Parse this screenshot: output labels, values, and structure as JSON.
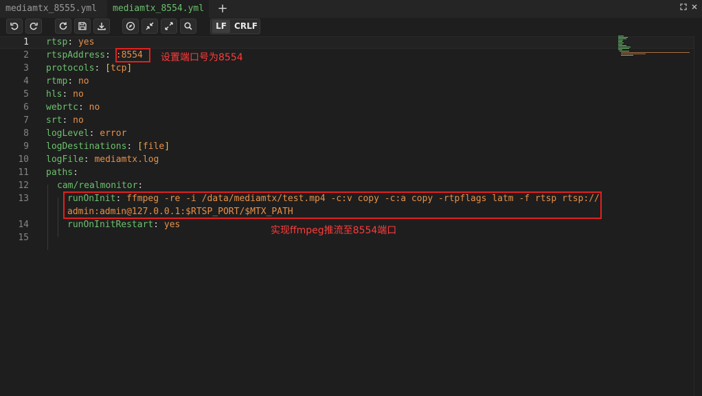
{
  "tabs": [
    {
      "label": "mediamtx_8555.yml",
      "active": false
    },
    {
      "label": "mediamtx_8554.yml",
      "active": true
    }
  ],
  "toolbar": {
    "icons": [
      "undo-icon",
      "redo-icon",
      "reload-icon",
      "save-icon",
      "download-icon",
      "compass-icon",
      "collapse-icon",
      "expand-icon",
      "search-icon"
    ],
    "eol_lf": "LF",
    "eol_crlf": "CRLF"
  },
  "editor": {
    "lines": [
      {
        "n": "1",
        "key": "rtsp",
        "val": "yes"
      },
      {
        "n": "2",
        "key": "rtspAddress",
        "val": ":8554"
      },
      {
        "n": "3",
        "key": "protocols",
        "val": "tcp"
      },
      {
        "n": "4",
        "key": "rtmp",
        "val": "no"
      },
      {
        "n": "5",
        "key": "hls",
        "val": "no"
      },
      {
        "n": "6",
        "key": "webrtc",
        "val": "no"
      },
      {
        "n": "7",
        "key": "srt",
        "val": "no"
      },
      {
        "n": "8",
        "key": "logLevel",
        "val": "error"
      },
      {
        "n": "9",
        "key": "logDestinations",
        "val": "file"
      },
      {
        "n": "10",
        "key": "logFile",
        "val": "mediamtx.log"
      },
      {
        "n": "11",
        "key": "paths",
        "val": ""
      },
      {
        "n": "12",
        "key": "cam/realmonitor",
        "val": ""
      },
      {
        "n": "13",
        "key": "runOnInit",
        "val": "ffmpeg -re -i /data/mediamtx/test.mp4 -c:v copy -c:a copy -rtpflags latm -f rtsp rtsp://",
        "cont": "admin:admin@127.0.0.1:$RTSP_PORT/$MTX_PATH"
      },
      {
        "n": "14",
        "key": "runOnInitRestart",
        "val": "yes"
      },
      {
        "n": "15",
        "key": "",
        "val": ""
      }
    ]
  },
  "annotations": {
    "port": "设置端口号为8554",
    "ffmpeg": "实现ffmpeg推流至8554端口"
  },
  "colors": {
    "key": "#6cc06e",
    "value": "#e8914a",
    "bracket": "#e6c14b",
    "annotation": "#e62020"
  }
}
